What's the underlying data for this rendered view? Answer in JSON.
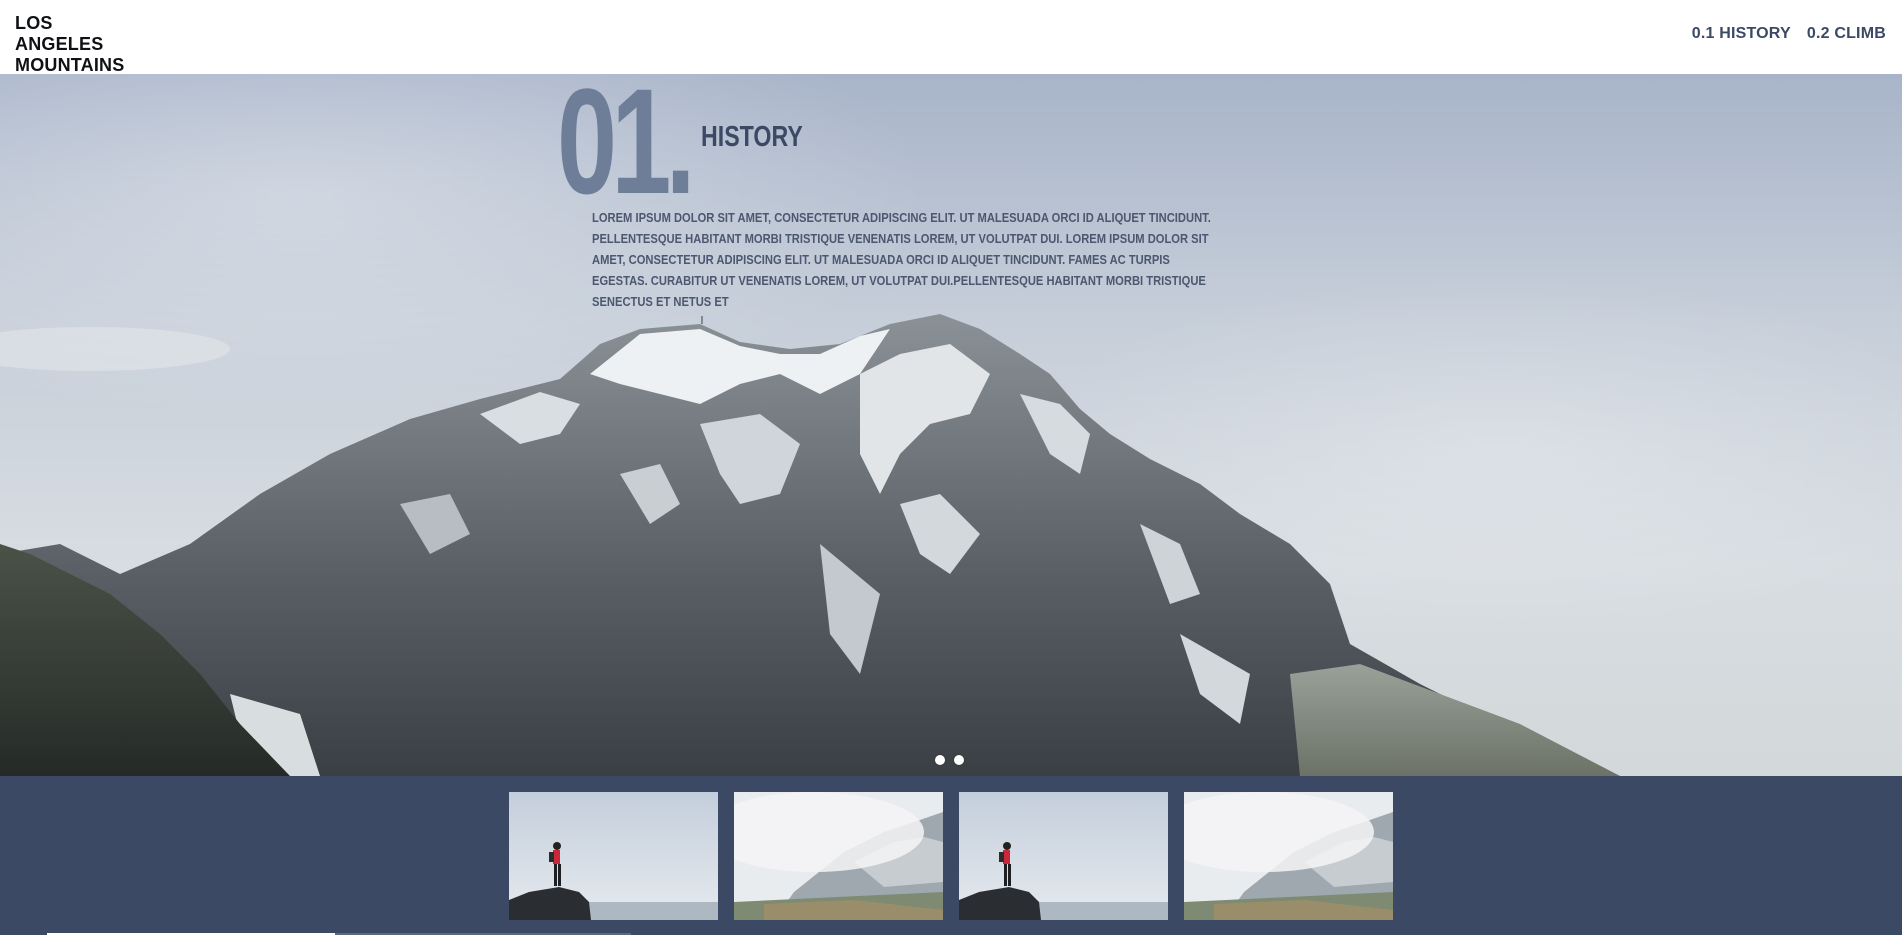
{
  "brand": {
    "line1": "LOS ANGELES",
    "line2": "MOUNTAINS"
  },
  "nav": {
    "items": [
      {
        "label": "0.1 HISTORY"
      },
      {
        "label": "0.2 CLIMB"
      }
    ]
  },
  "hero": {
    "number": "01.",
    "heading": "HISTORY",
    "body": "LOREM IPSUM DOLOR SIT AMET, CONSECTETUR ADIPISCING ELIT. UT MALESUADA ORCI ID ALIQUET TINCIDUNT. PELLENTESQUE HABITANT MORBI TRISTIQUE VENENATIS LOREM, UT VOLUTPAT DUI. LOREM IPSUM DOLOR SIT AMET, CONSECTETUR ADIPISCING ELIT. UT MALESUADA ORCI ID ALIQUET TINCIDUNT. FAMES AC TURPIS EGESTAS. CURABITUR UT VENENATIS LOREM, UT VOLUTPAT DUI.PELLENTESQUE HABITANT MORBI TRISTIQUE SENECTUS ET NETUS ET",
    "image_icon": "snowy-mountain-image"
  },
  "carousel": {
    "dots": [
      {
        "active": true
      },
      {
        "active": false
      }
    ]
  },
  "thumbnails": [
    {
      "icon": "hiker-on-rock-thumbnail"
    },
    {
      "icon": "misty-mountain-thumbnail"
    },
    {
      "icon": "hiker-on-rock-thumbnail"
    },
    {
      "icon": "misty-mountain-thumbnail"
    }
  ],
  "colors": {
    "navy": "#3b4965",
    "number_gray": "#6f7e98",
    "header_bg": "#ffffff",
    "logo_text": "#0f1115"
  }
}
